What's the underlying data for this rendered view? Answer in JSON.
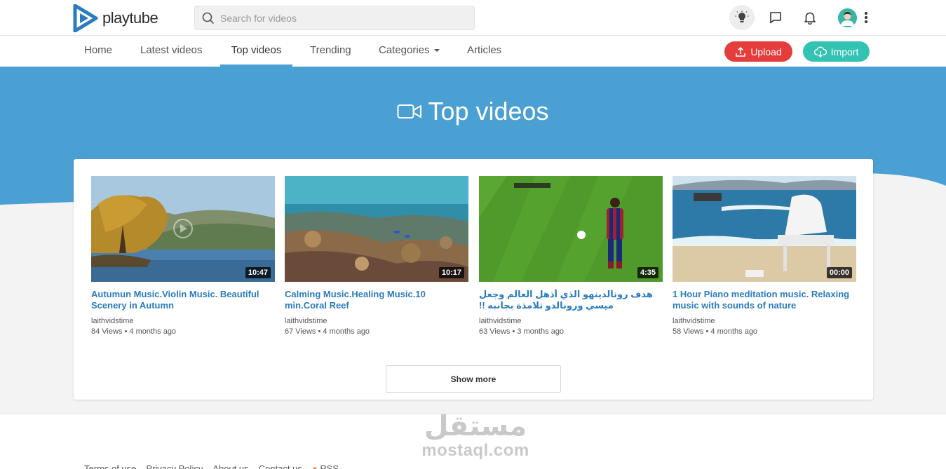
{
  "header": {
    "logo_text": "playtube",
    "search_placeholder": "Search for videos",
    "icons": [
      "lightbulb-icon",
      "message-icon",
      "bell-icon",
      "avatar",
      "more-vertical-icon"
    ]
  },
  "nav": {
    "items": [
      {
        "label": "Home"
      },
      {
        "label": "Latest videos"
      },
      {
        "label": "Top videos",
        "active": true
      },
      {
        "label": "Trending"
      },
      {
        "label": "Categories"
      },
      {
        "label": "Articles"
      }
    ],
    "upload_label": "Upload",
    "import_label": "Import"
  },
  "banner": {
    "title": "Top videos",
    "color": "#4a9fd3"
  },
  "videos": [
    {
      "title": "Autumun Music.Violin Music. Beautiful Scenery in Autumn",
      "duration": "10:47",
      "channel": "laithvidstime",
      "meta": "84 Views • 4 months ago"
    },
    {
      "title": "Calming Music.Healing Music.10 min.Coral Reef",
      "duration": "10:17",
      "channel": "laithvidstime",
      "meta": "67 Views • 4 months ago"
    },
    {
      "title": "هدف رونالدينهو الذي أذهل العالم وجعل ميسي ورونالدو تلامذة بجانبه !!",
      "duration": "4:35",
      "channel": "laithvidstime",
      "meta": "63 Views • 3 months ago"
    },
    {
      "title": "1 Hour Piano meditation music. Relaxing music with sounds of nature",
      "duration": "00:00",
      "channel": "laithvidstime",
      "meta": "58 Views • 4 months ago"
    }
  ],
  "show_more_label": "Show more",
  "watermark": {
    "arabic": "مستقل",
    "latin": "mostaql.com"
  },
  "footer": {
    "links": [
      "Terms of use",
      "Privacy Policy",
      "About us",
      "Contact us",
      "RSS"
    ]
  },
  "colors": {
    "accent": "#4a9fd3",
    "title_link": "#2a7cc0",
    "upload": "#e53c3c",
    "import": "#33c3b2"
  }
}
